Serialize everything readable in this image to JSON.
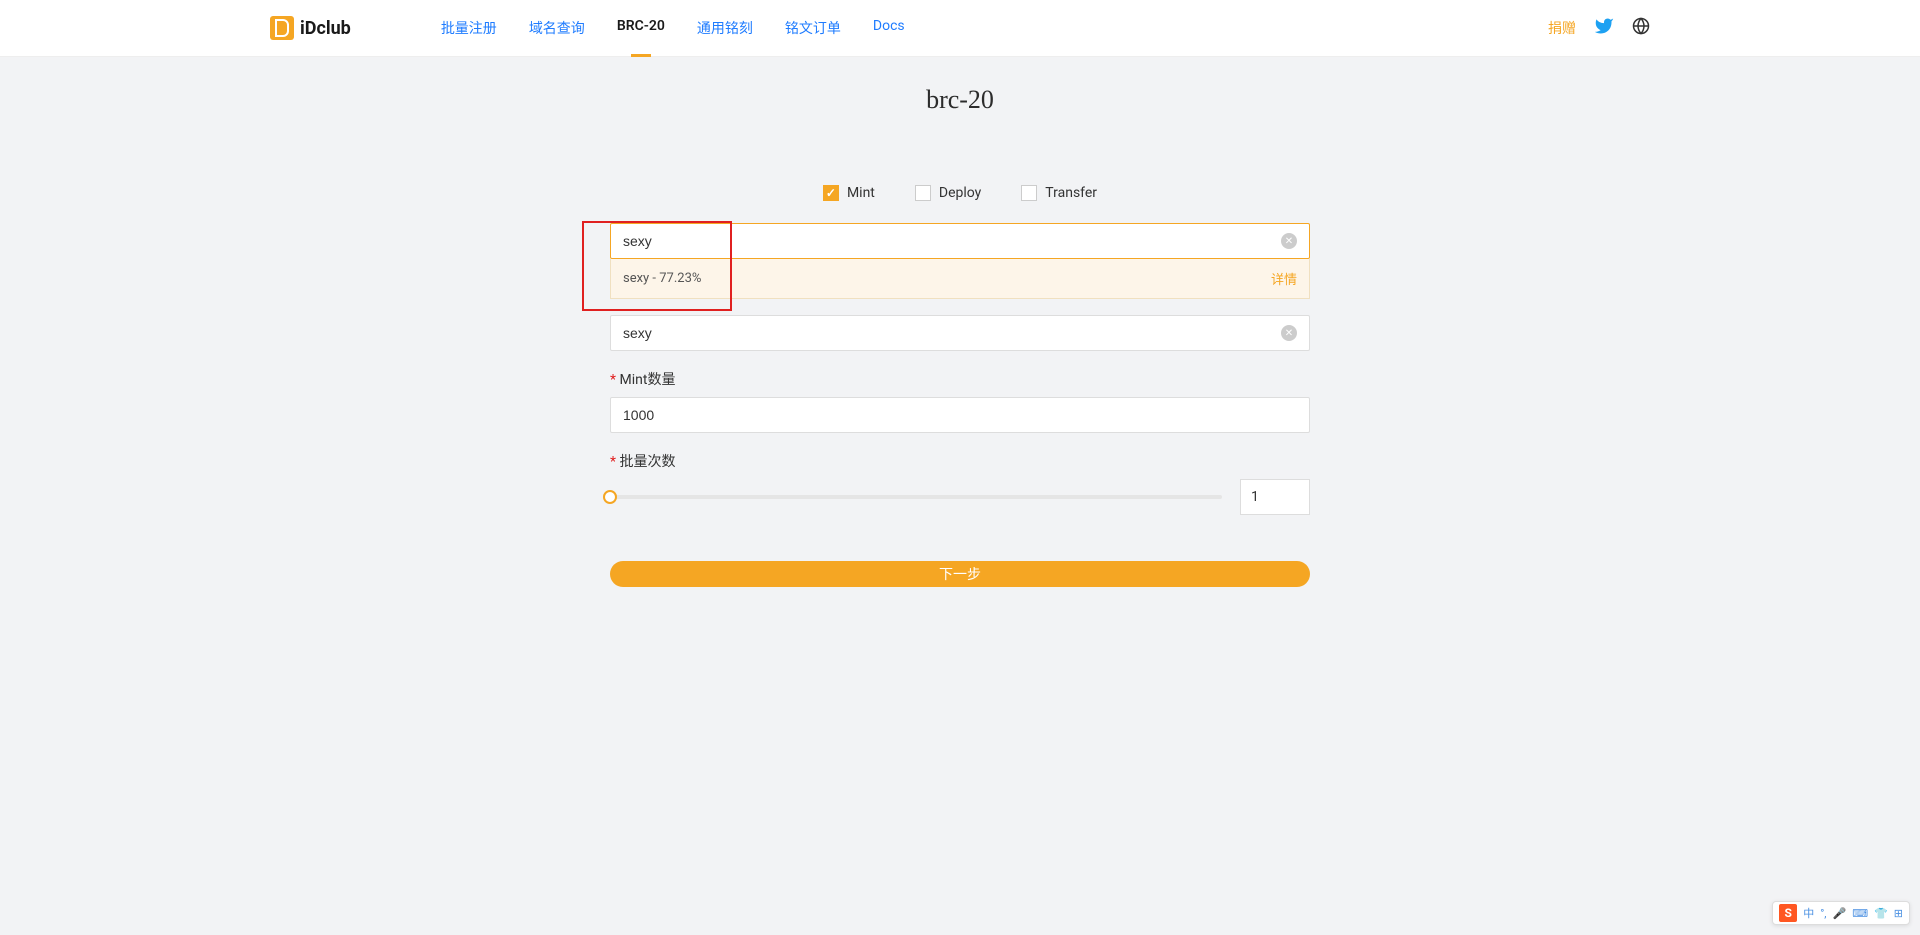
{
  "header": {
    "logo_text": "iDclub",
    "nav": [
      {
        "label": "批量注册",
        "active": false
      },
      {
        "label": "域名查询",
        "active": false
      },
      {
        "label": "BRC-20",
        "active": true
      },
      {
        "label": "通用铭刻",
        "active": false
      },
      {
        "label": "铭文订单",
        "active": false
      },
      {
        "label": "Docs",
        "active": false
      }
    ],
    "donate": "捐赠"
  },
  "page": {
    "title": "brc-20"
  },
  "checkboxes": [
    {
      "label": "Mint",
      "checked": true
    },
    {
      "label": "Deploy",
      "checked": false
    },
    {
      "label": "Transfer",
      "checked": false
    }
  ],
  "search": {
    "value": "sexy",
    "suggestion_text": "sexy - 77.23%",
    "suggestion_link": "详情"
  },
  "token_field": {
    "value": "sexy"
  },
  "mint_amount": {
    "label": "Mint数量",
    "value": "1000"
  },
  "batch": {
    "label": "批量次数",
    "value": "1"
  },
  "submit": {
    "label": "下一步"
  },
  "ime": {
    "lang": "中"
  }
}
